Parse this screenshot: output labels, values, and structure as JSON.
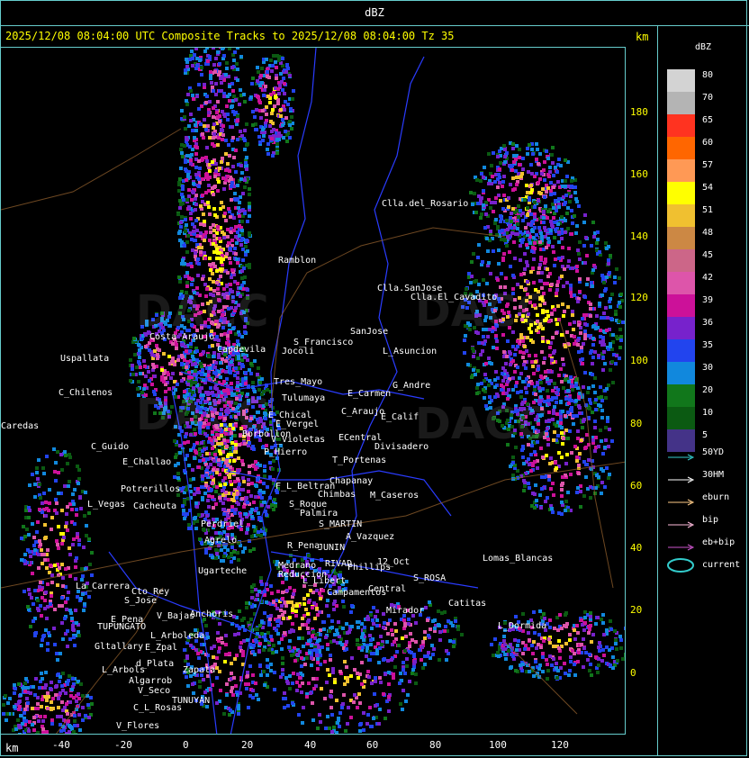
{
  "header": {
    "title": "dBZ",
    "status": "2025/12/08 08:04:00 UTC Composite Tracks to 2025/12/08 08:04:00 Tz 35",
    "km_label": "km"
  },
  "x_axis": {
    "unit": "km",
    "ticks": [
      "-40",
      "-20",
      "0",
      "20",
      "40",
      "60",
      "80",
      "100",
      "120"
    ]
  },
  "y_axis": {
    "ticks": [
      "180",
      "160",
      "140",
      "120",
      "100",
      "80",
      "60",
      "40",
      "20",
      "0"
    ]
  },
  "legend": {
    "title": "dBZ",
    "levels": [
      {
        "label": "80",
        "color": "#d3d3d3"
      },
      {
        "label": "70",
        "color": "#b4b4b4"
      },
      {
        "label": "65",
        "color": "#ff3320"
      },
      {
        "label": "60",
        "color": "#ff6600"
      },
      {
        "label": "57",
        "color": "#ff9955"
      },
      {
        "label": "54",
        "color": "#ffff00"
      },
      {
        "label": "51",
        "color": "#f0c030"
      },
      {
        "label": "48",
        "color": "#cc8844"
      },
      {
        "label": "45",
        "color": "#cc6688"
      },
      {
        "label": "42",
        "color": "#dd55aa"
      },
      {
        "label": "39",
        "color": "#cc1199"
      },
      {
        "label": "36",
        "color": "#7722cc"
      },
      {
        "label": "35",
        "color": "#2244ee"
      },
      {
        "label": "30",
        "color": "#1188dd"
      },
      {
        "label": "20",
        "color": "#11771b"
      },
      {
        "label": "10",
        "color": "#0b5a12"
      },
      {
        "label": "5",
        "color": "#443388"
      }
    ],
    "tracks": [
      {
        "label": "50YD",
        "color": "#33cccc"
      },
      {
        "label": "30HM",
        "color": "#ffffff"
      },
      {
        "label": "eburn",
        "color": "#ffcc88"
      },
      {
        "label": "bip",
        "color": "#ffbbdd"
      },
      {
        "label": "eb+bip",
        "color": "#cc55cc"
      },
      {
        "label": "current",
        "color": "#33cccc"
      }
    ]
  },
  "watermark": "DACC",
  "places": [
    "Clla.del_Rosario",
    "Ramblon",
    "Clla.SanJose",
    "Clla.El_Cavadito",
    "S_Francisco",
    "SanJose",
    "Jocoli",
    "L_Asuncion",
    "Tres_Mayo",
    "Tulumaya",
    "G_Andre",
    "E_Carmen",
    "E_Chical",
    "E_Vergel",
    "C_Araujo",
    "E_Calif",
    "Uspallata",
    "C_Chilenos",
    "Caredas",
    "Costa_Araujo",
    "Capdevila",
    "C_Guido",
    "Borbollon",
    "P_Hierro",
    "V_Violetas",
    "ECentral",
    "Divisadero",
    "T_Portenas",
    "E_Challao",
    "Potrerillos",
    "L_Vegas",
    "Cacheuta",
    "F_L_Beltran",
    "Chapanay",
    "Chimbas",
    "M_Caseros",
    "S_Roque",
    "Palmira",
    "Perdriel",
    "S_MARTIN",
    "Agrelo",
    "R_Pena",
    "JUNIN",
    "A_Vazquez",
    "12_Oct",
    "Ugarteche",
    "Medrano",
    "Reduccion",
    "RIVAD",
    "Phillips",
    "S_ROSA",
    "Lomas_Blancas",
    "La_Carrera",
    "Cto_Rey",
    "S_Jose",
    "L_Libert",
    "Campamentos",
    "Central",
    "Catitas",
    "V_Bajas",
    "E_Pena",
    "Anchoris",
    "TUPUNGATO",
    "Mirador",
    "L_Dormida",
    "L_Arboleda",
    "Gltallary",
    "E_Zpal",
    "d_Plata",
    "L_Arbols",
    "Algarrob",
    "V_Seco",
    "Zapata",
    "TUNUYAN",
    "C_L_Rosas",
    "V_Flores"
  ]
}
